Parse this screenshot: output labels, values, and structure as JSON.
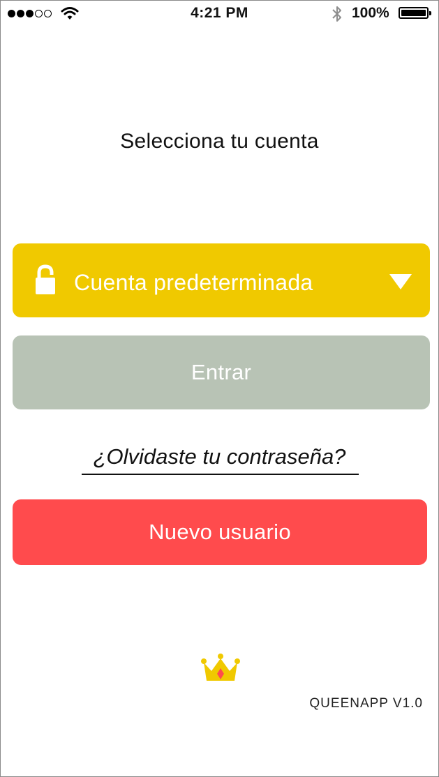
{
  "status_bar": {
    "signal_filled": 3,
    "signal_total": 5,
    "time": "4:21 PM",
    "battery_percent": "100%",
    "icons": [
      "wifi-icon",
      "bluetooth-icon",
      "battery-icon"
    ]
  },
  "title": "Selecciona tu cuenta",
  "account_select": {
    "label": "Cuenta predeterminada",
    "icon": "lock-open-icon",
    "caret_icon": "caret-down-icon",
    "color": "#f0c900"
  },
  "enter_button": {
    "label": "Entrar",
    "color": "#b8c3b5"
  },
  "forgot_password": {
    "label": "¿Olvidaste tu contraseña?"
  },
  "new_user_button": {
    "label": "Nuevo usuario",
    "color": "#ff4b4d"
  },
  "footer": {
    "logo_icon": "crown-icon",
    "version": "QUEENAPP V1.0"
  }
}
